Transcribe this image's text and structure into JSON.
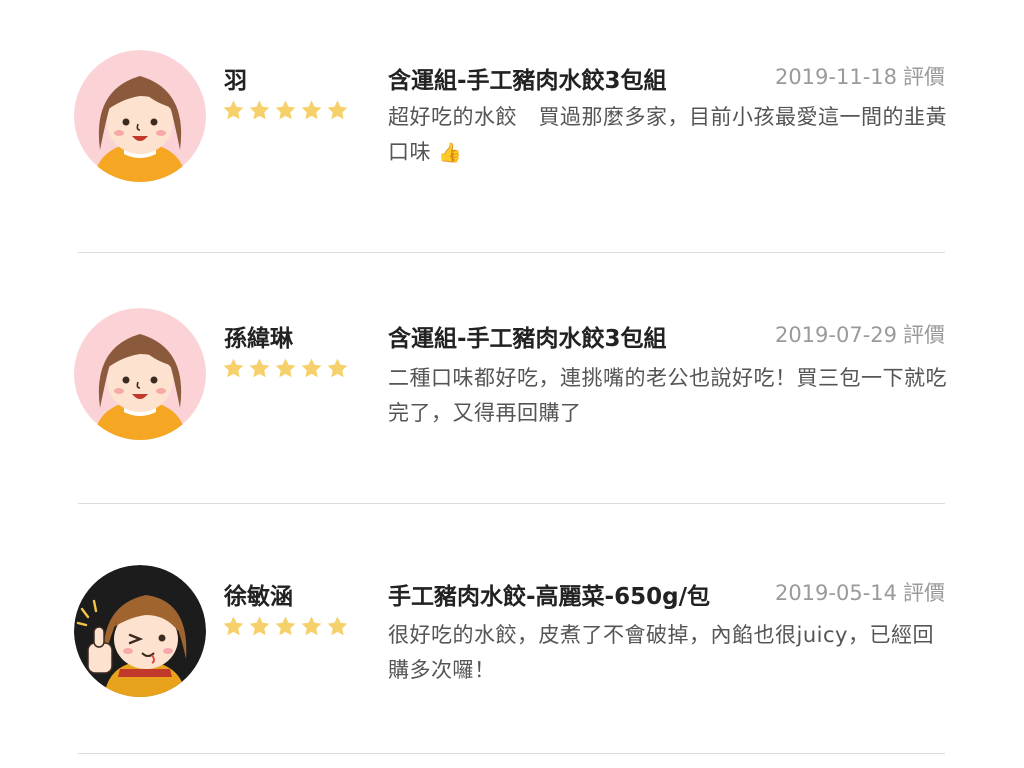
{
  "reviews": [
    {
      "reviewer": "羽",
      "rating": 5,
      "product": "含運組-手工豬肉水餃3包組",
      "date": "2019-11-18",
      "date_suffix": "評價",
      "comment": "超好吃的水餃　買過那麼多家，目前小孩最愛這一間的韭黃口味",
      "comment_emoji": "👍",
      "avatar_icon": "girl-avatar-icon"
    },
    {
      "reviewer": "孫緯琳",
      "rating": 5,
      "product": "含運組-手工豬肉水餃3包組",
      "date": "2019-07-29",
      "date_suffix": "評價",
      "comment": "二種口味都好吃，連挑嘴的老公也說好吃！買三包一下就吃完了，又得再回購了",
      "comment_emoji": "",
      "avatar_icon": "girl-avatar-icon"
    },
    {
      "reviewer": "徐敏涵",
      "rating": 5,
      "product": "手工豬肉水餃-高麗菜-650g/包",
      "date": "2019-05-14",
      "date_suffix": "評價",
      "comment": "很好吃的水餃，皮煮了不會破掉，內餡也很juicy，已經回購多次囉！",
      "comment_emoji": "",
      "avatar_icon": "thumbs-up-girl-avatar-icon"
    }
  ],
  "colors": {
    "star": "#f5d06b",
    "divider": "#dcdcdc",
    "date": "#9a9a9a",
    "avatar_bg_pink": "#fbd3d6",
    "avatar_bg_dark": "#1c1c1c"
  }
}
